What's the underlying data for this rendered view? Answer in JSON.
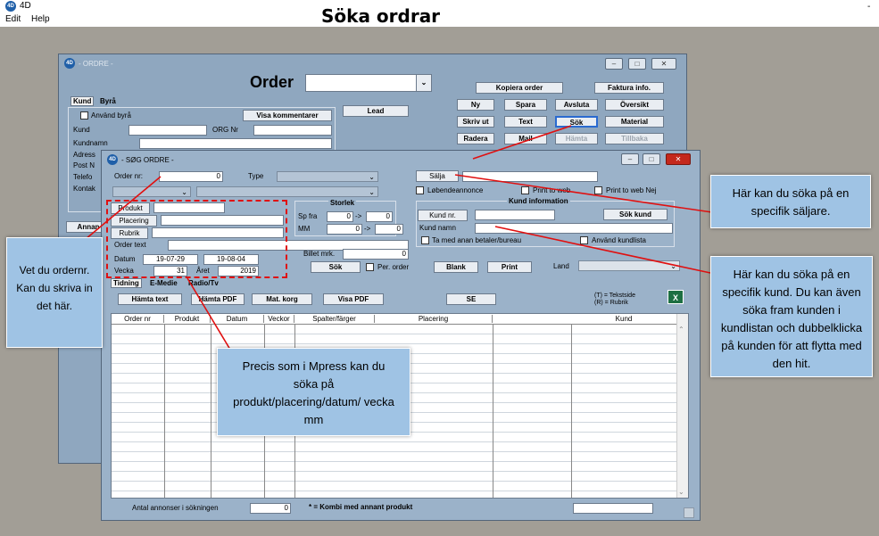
{
  "app": {
    "name": "4D",
    "menu": [
      "Edit",
      "Help"
    ],
    "title": "Söka ordrar"
  },
  "order_window": {
    "title": "- ORDRE -",
    "heading": "Order",
    "tabs": [
      "Kund",
      "Byrå"
    ],
    "use_agency": "Använd byrå",
    "show_comments": "Visa kommentarer",
    "lead": "Lead",
    "labels": [
      "Kund",
      "Kundnamn",
      "Adress",
      "Post N",
      "Telefo",
      "Kontak"
    ],
    "org_nr": "ORG Nr",
    "annan": "Annan",
    "buttons": {
      "copy_order": "Kopiera order",
      "invoice_info": "Faktura info.",
      "new": "Ny",
      "save": "Spara",
      "cancel": "Avsluta",
      "overview": "Översikt",
      "print": "Skriv ut",
      "text": "Text",
      "search": "Sök",
      "material": "Material",
      "delete": "Radera",
      "mail": "Mail",
      "fetch": "Hämta",
      "back": "Tillbaka"
    }
  },
  "search_window": {
    "title": "- SØG ORDRE -",
    "order_nr_label": "Order nr:",
    "order_nr_value": "0",
    "type_label": "Type",
    "seller_button": "Sälja",
    "running_ad": "Løbendeannonce",
    "print_to_web": "Print to web",
    "print_to_web_no": "Print to web Nej",
    "product_button": "Produkt",
    "placement_button": "Placering",
    "rubric_button": "Rubrik",
    "order_text_label": "Order text",
    "date_label": "Datum",
    "date_from": "19-07-29",
    "date_to": "19-08-04",
    "week_label": "Vecka",
    "week_value": "31",
    "year_label": "Året",
    "year_value": "2019",
    "size_title": "Storlek",
    "sp_from_label": "Sp fra",
    "sp_from": "0",
    "sp_to": "0",
    "mm_label": "MM",
    "mm_from": "0",
    "mm_to": "0",
    "arrow": "->",
    "customer_info_title": "Kund information",
    "customer_nr_button": "Kund nr.",
    "search_customer_button": "Sök kund",
    "customer_name_label": "Kund namn",
    "other_payer": "Ta med anan betaler/bureau",
    "use_customer_list": "Använd kundlista",
    "billet_label": "Billet mrk.",
    "billet_value": "0",
    "search_button": "Sök",
    "per_order": "Per. order",
    "blank_button": "Blank",
    "print_button": "Print",
    "country_label": "Land",
    "tabs": [
      "Tidning",
      "E-Medie",
      "Radio/Tv"
    ],
    "fetch_text": "Hämta text",
    "fetch_pdf": "Hämta PDF",
    "mat_basket": "Mat. korg",
    "show_pdf": "Visa PDF",
    "se": "SE",
    "legend_t": "(T) = Tekstside",
    "legend_r": "(R) = Rubrik",
    "columns": [
      "Order nr",
      "Produkt",
      "Datum",
      "Veckor",
      "Spalter/färger",
      "Placering",
      "",
      "Kund"
    ],
    "count_label": "Antal annonser i sökningen",
    "count_value": "0",
    "combo_note": "* = Kombi med annant produkt"
  },
  "callouts": {
    "seller": "Här kan du söka på en specifik säljare.",
    "customer": "Här kan du söka på en specifik kund. Du kan även söka fram kunden i kundlistan och dubbelklicka på kunden för att flytta med den hit.",
    "order_nr": "Vet du ordernr. Kan du skriva in det här.",
    "mpress": "Precis som i Mpress kan du söka på produkt/placering/datum/ vecka mm"
  },
  "colors": {
    "annotation": "#e01010",
    "callout": "#9fc3e4",
    "window": "#8fa7bf"
  }
}
